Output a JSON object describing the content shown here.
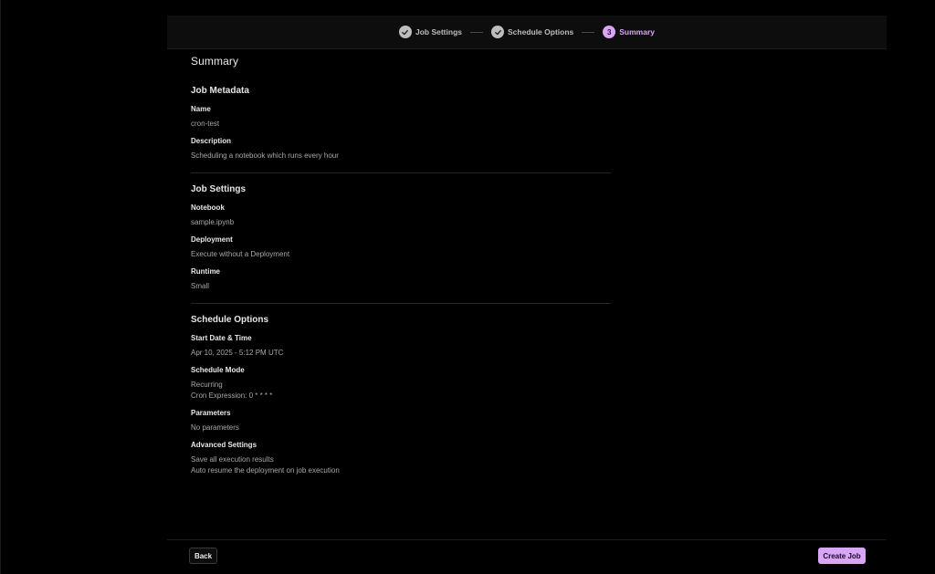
{
  "stepper": {
    "steps": [
      {
        "number": "1",
        "label": "Job Settings",
        "state": "done"
      },
      {
        "number": "2",
        "label": "Schedule Options",
        "state": "done"
      },
      {
        "number": "3",
        "label": "Summary",
        "state": "active"
      }
    ]
  },
  "summary": {
    "title": "Summary",
    "job_metadata": {
      "title": "Job Metadata",
      "name_label": "Name",
      "name_value": "cron-test",
      "description_label": "Description",
      "description_value": "Scheduling a notebook which runs every hour"
    },
    "job_settings": {
      "title": "Job Settings",
      "notebook_label": "Notebook",
      "notebook_value": "sample.ipynb",
      "deployment_label": "Deployment",
      "deployment_value": "Execute without a Deployment",
      "runtime_label": "Runtime",
      "runtime_value": "Small"
    },
    "schedule_options": {
      "title": "Schedule Options",
      "start_label": "Start Date & Time",
      "start_value": "Apr 10, 2025 - 5:12 PM UTC",
      "mode_label": "Schedule Mode",
      "mode_value": "Recurring",
      "cron_value": "Cron Expression: 0 * * * *",
      "parameters_label": "Parameters",
      "parameters_value": "No parameters",
      "advanced_label": "Advanced Settings",
      "advanced_value_1": "Save all execution results",
      "advanced_value_2": "Auto resume the deployment on job execution"
    }
  },
  "footer": {
    "back_label": "Back",
    "create_label": "Create Job"
  },
  "colors": {
    "accent": "#d9a6f5",
    "background": "#000000",
    "step_done": "#bdbdbd"
  },
  "icons": {
    "step_done": "check-icon"
  }
}
